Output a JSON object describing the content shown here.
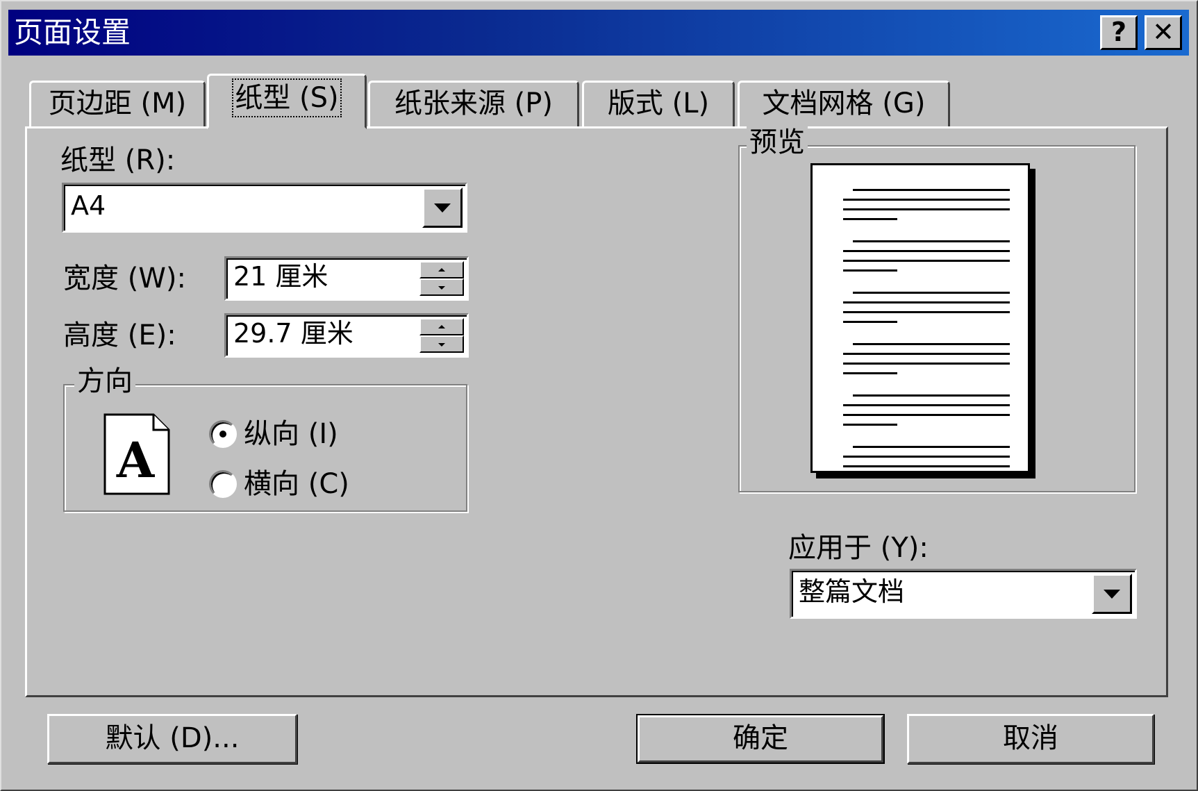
{
  "window": {
    "title": "页面设置",
    "help_label": "?",
    "close_label": "✕"
  },
  "tabs": [
    {
      "label": "页边距 (M)",
      "active": false
    },
    {
      "label": "纸型 (S)",
      "active": true
    },
    {
      "label": "纸张来源 (P)",
      "active": false
    },
    {
      "label": "版式 (L)",
      "active": false
    },
    {
      "label": "文档网格 (G)",
      "active": false
    }
  ],
  "paper": {
    "size_label": "纸型 (R):",
    "size_value": "A4",
    "width_label": "宽度 (W):",
    "width_value": "21 厘米",
    "height_label": "高度 (E):",
    "height_value": "29.7 厘米"
  },
  "orientation": {
    "legend": "方向",
    "icon_letter": "A",
    "portrait_label": "纵向 (I)",
    "landscape_label": "横向 (C)",
    "selected": "portrait"
  },
  "preview": {
    "legend": "预览"
  },
  "apply": {
    "label": "应用于 (Y):",
    "value": "整篇文档"
  },
  "buttons": {
    "default_label": "默认 (D)...",
    "ok_label": "确定",
    "cancel_label": "取消"
  }
}
